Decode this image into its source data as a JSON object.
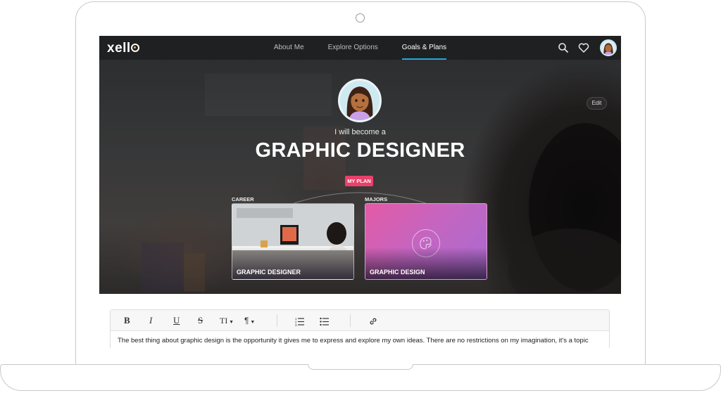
{
  "nav": {
    "logo": "xello",
    "links": [
      "About Me",
      "Explore Options",
      "Goals & Plans"
    ],
    "active": "Goals & Plans"
  },
  "hero": {
    "subtitle": "I will become a",
    "title": "GRAPHIC DESIGNER",
    "edit_label": "Edit",
    "plan_badge": "MY PLAN",
    "career": {
      "label": "CAREER",
      "title": "GRAPHIC DESIGNER"
    },
    "majors": {
      "label": "MAJORS",
      "title": "GRAPHIC DESIGN"
    }
  },
  "editor": {
    "toolbar": {
      "bold": "B",
      "italic": "I",
      "underline": "U",
      "strike": "S",
      "text_size": "TI",
      "paragraph": "¶"
    },
    "content": "The best thing about graphic design is the opportunity it gives me to express and explore my own ideas. There are no restrictions on my imagination, it's a topic"
  },
  "colors": {
    "nav_bg": "#1f2021",
    "active_underline": "#20a8d8",
    "badge": "#e9416a",
    "majors_card": "#c266c2"
  },
  "icons": [
    "search-icon",
    "heart-icon",
    "ordered-list-icon",
    "bullet-list-icon",
    "link-icon"
  ]
}
